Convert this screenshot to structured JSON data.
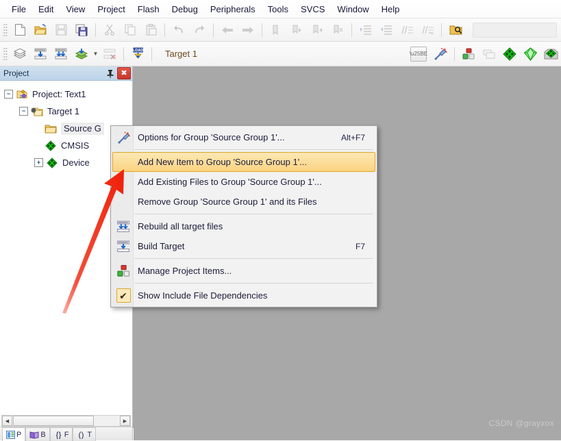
{
  "app": {
    "title": "Keil uVision",
    "accent_highlight": "#fbd381",
    "accent_border": "#e0a42c",
    "panel_header_color": "#bcd3e8",
    "editor_background": "#a8a8a8",
    "annotation_arrow_color": "#f01f08"
  },
  "menubar": {
    "items": [
      {
        "label": "File"
      },
      {
        "label": "Edit"
      },
      {
        "label": "View"
      },
      {
        "label": "Project"
      },
      {
        "label": "Flash"
      },
      {
        "label": "Debug"
      },
      {
        "label": "Peripherals"
      },
      {
        "label": "Tools"
      },
      {
        "label": "SVCS"
      },
      {
        "label": "Window"
      },
      {
        "label": "Help"
      }
    ]
  },
  "toolbar_main": {
    "buttons": [
      {
        "name": "new-file-icon",
        "glyph": "🗋",
        "disabled": false
      },
      {
        "name": "open-folder-icon",
        "glyph": "📂",
        "disabled": false
      },
      {
        "name": "save-icon",
        "glyph": "💾",
        "disabled": true
      },
      {
        "name": "save-all-icon",
        "glyph": "🖫",
        "disabled": false
      },
      {
        "name": "cut-icon",
        "glyph": "✂",
        "disabled": true
      },
      {
        "name": "copy-icon",
        "glyph": "⧉",
        "disabled": true
      },
      {
        "name": "paste-icon",
        "glyph": "📋",
        "disabled": true
      },
      {
        "name": "undo-icon",
        "glyph": "↶",
        "disabled": true
      },
      {
        "name": "redo-icon",
        "glyph": "↷",
        "disabled": true
      },
      {
        "name": "navigate-back-icon",
        "glyph": "←",
        "disabled": true
      },
      {
        "name": "navigate-forward-icon",
        "glyph": "→",
        "disabled": true
      },
      {
        "name": "bookmark-toggle-icon",
        "glyph": "⚑",
        "disabled": true
      },
      {
        "name": "bookmark-prev-icon",
        "glyph": "⚑",
        "disabled": true
      },
      {
        "name": "bookmark-next-icon",
        "glyph": "⚑",
        "disabled": true
      },
      {
        "name": "bookmark-clear-icon",
        "glyph": "⚑",
        "disabled": true
      },
      {
        "name": "indent-icon",
        "glyph": "≡",
        "disabled": true
      },
      {
        "name": "outdent-icon",
        "glyph": "≡",
        "disabled": true
      },
      {
        "name": "comment-lines-icon",
        "glyph": "//≡",
        "disabled": true
      },
      {
        "name": "uncomment-lines-icon",
        "glyph": "//≡",
        "disabled": true
      },
      {
        "name": "find-in-files-icon",
        "glyph": "🔍",
        "disabled": false
      }
    ],
    "search_placeholder": ""
  },
  "toolbar_build": {
    "buttons": [
      {
        "name": "translate-file-icon",
        "disabled": false
      },
      {
        "name": "build-target-icon",
        "disabled": false
      },
      {
        "name": "rebuild-all-icon",
        "disabled": false
      },
      {
        "name": "batch-build-icon",
        "disabled": false
      },
      {
        "name": "stop-build-icon",
        "disabled": true
      },
      {
        "name": "download-to-flash-icon",
        "disabled": false
      }
    ],
    "target_value": "Target 1",
    "after_buttons": [
      {
        "name": "target-options-icon"
      },
      {
        "name": "manage-project-items-icon"
      },
      {
        "name": "manage-multi-project-icon"
      },
      {
        "name": "pack-installer-icon"
      },
      {
        "name": "run-time-environment-icon"
      },
      {
        "name": "manage-rte-icon"
      }
    ]
  },
  "project_panel": {
    "title": "Project",
    "pin_icon": "pin-icon",
    "close_label": "✖",
    "tree": [
      {
        "label": "Project: Text1",
        "icon": "project-icon",
        "expander": "−",
        "depth": 0,
        "selected": false
      },
      {
        "label": "Target 1",
        "icon": "target-folder-icon",
        "expander": "−",
        "depth": 1,
        "selected": false
      },
      {
        "label": "Source G",
        "icon": "folder-icon",
        "expander": "",
        "depth": 2,
        "selected": true
      },
      {
        "label": "CMSIS",
        "icon": "component-icon",
        "expander": "",
        "depth": 2,
        "selected": false
      },
      {
        "label": "Device",
        "icon": "component-icon",
        "expander": "+",
        "depth": 2,
        "selected": false
      }
    ],
    "tabs": [
      {
        "label": "P",
        "icon": "project-tab-icon",
        "active": true
      },
      {
        "label": "B",
        "icon": "books-tab-icon",
        "active": false
      },
      {
        "label": "F",
        "icon": "functions-tab-icon",
        "active": false
      },
      {
        "label": "T",
        "icon": "templates-tab-icon",
        "active": false
      }
    ],
    "scrollbar": {
      "left_arrow": "◀",
      "right_arrow": "▶"
    }
  },
  "context_menu": {
    "items": [
      {
        "label": "Options for Group 'Source Group 1'...",
        "accel": "Alt+F7",
        "icon": "options-wand-icon",
        "highlighted": false,
        "separator_after": true
      },
      {
        "label": "Add New  Item to Group 'Source Group 1'...",
        "accel": "",
        "icon": "",
        "highlighted": true,
        "separator_after": false
      },
      {
        "label": "Add Existing Files to Group 'Source Group 1'...",
        "accel": "",
        "icon": "",
        "highlighted": false,
        "separator_after": false
      },
      {
        "label": "Remove Group 'Source Group 1' and its Files",
        "accel": "",
        "icon": "",
        "highlighted": false,
        "separator_after": true
      },
      {
        "label": "Rebuild all target files",
        "accel": "",
        "icon": "rebuild-icon",
        "highlighted": false,
        "separator_after": false
      },
      {
        "label": "Build Target",
        "accel": "F7",
        "icon": "build-icon",
        "highlighted": false,
        "separator_after": true
      },
      {
        "label": "Manage Project Items...",
        "accel": "",
        "icon": "manage-items-icon",
        "highlighted": false,
        "separator_after": true
      },
      {
        "label": "Show Include File Dependencies",
        "accel": "",
        "icon": "checkmark-icon",
        "highlighted": false,
        "separator_after": false
      }
    ]
  },
  "watermark": {
    "text": "CSDN @grayxox"
  }
}
